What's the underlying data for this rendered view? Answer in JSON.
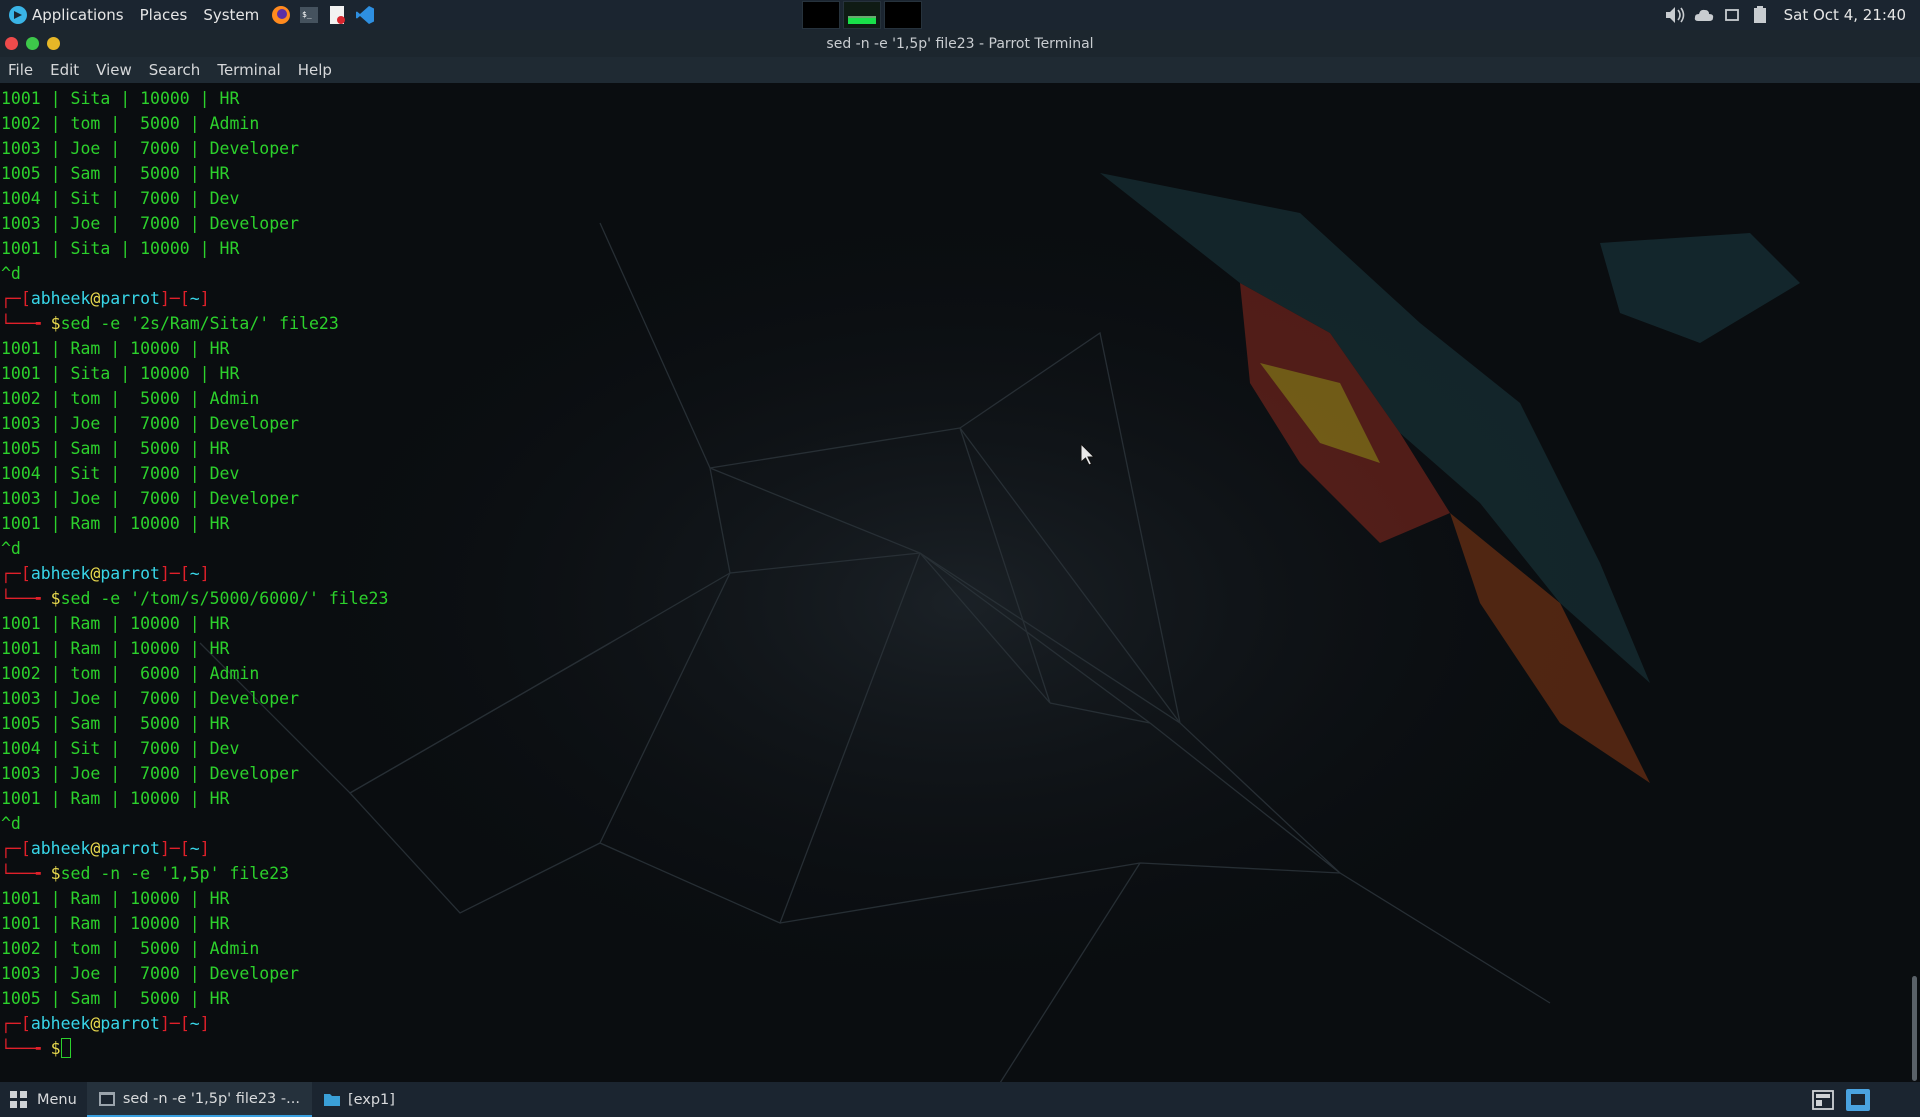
{
  "top_panel": {
    "menus": [
      "Applications",
      "Places",
      "System"
    ],
    "launchers": [
      "firefox-icon",
      "terminal-icon",
      "text-editor-icon",
      "vscode-icon"
    ],
    "clock": "Sat Oct  4, 21:40"
  },
  "window": {
    "title": "sed -n -e '1,5p' file23 - Parrot Terminal",
    "menu": [
      "File",
      "Edit",
      "View",
      "Search",
      "Terminal",
      "Help"
    ]
  },
  "terminal": {
    "prompt": {
      "user": "abheek",
      "at": "@",
      "host": "parrot",
      "dir": "~"
    },
    "lines": [
      {
        "type": "out",
        "text": "1001 | Sita | 10000 | HR"
      },
      {
        "type": "out",
        "text": "1002 | tom |  5000 | Admin"
      },
      {
        "type": "out",
        "text": "1003 | Joe |  7000 | Developer"
      },
      {
        "type": "out",
        "text": "1005 | Sam |  5000 | HR"
      },
      {
        "type": "out",
        "text": "1004 | Sit |  7000 | Dev"
      },
      {
        "type": "out",
        "text": "1003 | Joe |  7000 | Developer"
      },
      {
        "type": "out",
        "text": "1001 | Sita | 10000 | HR"
      },
      {
        "type": "out",
        "text": "^d"
      },
      {
        "type": "prompt"
      },
      {
        "type": "cmd",
        "text": "sed -e '2s/Ram/Sita/' file23"
      },
      {
        "type": "out",
        "text": "1001 | Ram | 10000 | HR"
      },
      {
        "type": "out",
        "text": "1001 | Sita | 10000 | HR"
      },
      {
        "type": "out",
        "text": "1002 | tom |  5000 | Admin"
      },
      {
        "type": "out",
        "text": "1003 | Joe |  7000 | Developer"
      },
      {
        "type": "out",
        "text": "1005 | Sam |  5000 | HR"
      },
      {
        "type": "out",
        "text": "1004 | Sit |  7000 | Dev"
      },
      {
        "type": "out",
        "text": "1003 | Joe |  7000 | Developer"
      },
      {
        "type": "out",
        "text": "1001 | Ram | 10000 | HR"
      },
      {
        "type": "out",
        "text": "^d"
      },
      {
        "type": "prompt"
      },
      {
        "type": "cmd",
        "text": "sed -e '/tom/s/5000/6000/' file23"
      },
      {
        "type": "out",
        "text": "1001 | Ram | 10000 | HR"
      },
      {
        "type": "out",
        "text": "1001 | Ram | 10000 | HR"
      },
      {
        "type": "out",
        "text": "1002 | tom |  6000 | Admin"
      },
      {
        "type": "out",
        "text": "1003 | Joe |  7000 | Developer"
      },
      {
        "type": "out",
        "text": "1005 | Sam |  5000 | HR"
      },
      {
        "type": "out",
        "text": "1004 | Sit |  7000 | Dev"
      },
      {
        "type": "out",
        "text": "1003 | Joe |  7000 | Developer"
      },
      {
        "type": "out",
        "text": "1001 | Ram | 10000 | HR"
      },
      {
        "type": "out",
        "text": "^d"
      },
      {
        "type": "prompt"
      },
      {
        "type": "cmd",
        "text": "sed -n -e '1,5p' file23"
      },
      {
        "type": "out",
        "text": "1001 | Ram | 10000 | HR"
      },
      {
        "type": "out",
        "text": "1001 | Ram | 10000 | HR"
      },
      {
        "type": "out",
        "text": "1002 | tom |  5000 | Admin"
      },
      {
        "type": "out",
        "text": "1003 | Joe |  7000 | Developer"
      },
      {
        "type": "out",
        "text": "1005 | Sam |  5000 | HR"
      },
      {
        "type": "prompt"
      },
      {
        "type": "cmd",
        "text": "",
        "cursor": true
      }
    ]
  },
  "taskbar": {
    "menu_label": "Menu",
    "tasks": [
      {
        "label": "sed -n -e '1,5p' file23 -...",
        "icon": "terminal-icon",
        "active": true
      },
      {
        "label": "[exp1]",
        "icon": "folder-icon",
        "active": false
      }
    ]
  },
  "colors": {
    "output": "#2cd12c",
    "prompt_bracket": "#e0202a",
    "prompt_user": "#38d6e8",
    "prompt_symbol": "#e9d94e",
    "panel": "#1b2530",
    "terminal_bg": "#0a0d10"
  }
}
